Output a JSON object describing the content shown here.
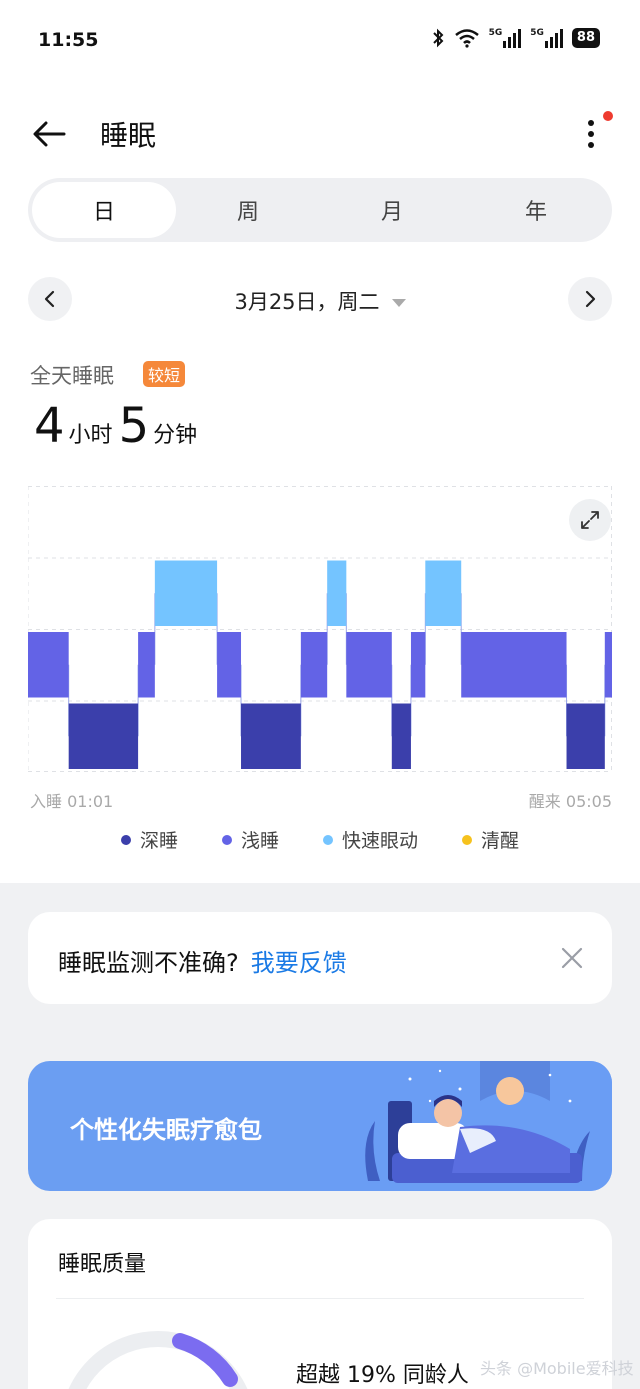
{
  "status_bar": {
    "time": "11:55",
    "signal_1": "5G",
    "signal_2": "5G",
    "battery": "88"
  },
  "header": {
    "title": "睡眠",
    "back_icon": "arrow-left-icon",
    "more_icon": "more-vertical-icon"
  },
  "tabs": [
    {
      "label": "日",
      "active": true
    },
    {
      "label": "周",
      "active": false
    },
    {
      "label": "月",
      "active": false
    },
    {
      "label": "年",
      "active": false
    }
  ],
  "date": {
    "label": "3月25日，周二"
  },
  "summary": {
    "label": "全天睡眠",
    "badge": "较短",
    "hours": "4",
    "hours_unit": "小时",
    "minutes": "5",
    "minutes_unit": "分钟"
  },
  "chart_data": {
    "type": "area",
    "title": "",
    "x_start": "01:01",
    "x_end": "05:05",
    "stages": [
      "深睡",
      "浅睡",
      "快速眼动",
      "清醒"
    ],
    "colors": {
      "深睡": "#3b3fab",
      "浅睡": "#6363e6",
      "快速眼动": "#74c4ff",
      "清醒": "#f6c21d"
    },
    "segments": [
      {
        "stage": "浅睡",
        "start": "01:01",
        "end": "01:18"
      },
      {
        "stage": "深睡",
        "start": "01:18",
        "end": "01:47"
      },
      {
        "stage": "浅睡",
        "start": "01:47",
        "end": "01:54"
      },
      {
        "stage": "快速眼动",
        "start": "01:54",
        "end": "02:20"
      },
      {
        "stage": "浅睡",
        "start": "02:20",
        "end": "02:30"
      },
      {
        "stage": "深睡",
        "start": "02:30",
        "end": "02:55"
      },
      {
        "stage": "浅睡",
        "start": "02:55",
        "end": "03:06"
      },
      {
        "stage": "快速眼动",
        "start": "03:06",
        "end": "03:14"
      },
      {
        "stage": "浅睡",
        "start": "03:14",
        "end": "03:33"
      },
      {
        "stage": "深睡",
        "start": "03:33",
        "end": "03:41"
      },
      {
        "stage": "浅睡",
        "start": "03:41",
        "end": "03:47"
      },
      {
        "stage": "快速眼动",
        "start": "03:47",
        "end": "04:02"
      },
      {
        "stage": "浅睡",
        "start": "04:02",
        "end": "04:46"
      },
      {
        "stage": "深睡",
        "start": "04:46",
        "end": "05:02"
      },
      {
        "stage": "浅睡",
        "start": "05:02",
        "end": "05:05"
      }
    ]
  },
  "chart_labels": {
    "start": "入睡 01:01",
    "end": "醒来 05:05"
  },
  "legend": [
    {
      "label": "深睡",
      "color": "#3b3fab"
    },
    {
      "label": "浅睡",
      "color": "#6363e6"
    },
    {
      "label": "快速眼动",
      "color": "#74c4ff"
    },
    {
      "label": "清醒",
      "color": "#f6c21d"
    }
  ],
  "feedback": {
    "question": "睡眠监测不准确?",
    "link": "我要反馈"
  },
  "banner": {
    "title": "个性化失眠疗愈包"
  },
  "quality": {
    "title": "睡眠质量",
    "compare_prefix": "超越",
    "compare_value": "19%",
    "compare_suffix": "同龄人",
    "ring_color": "#7b6cf0"
  },
  "watermark": "头条 @Mobile爱科技"
}
